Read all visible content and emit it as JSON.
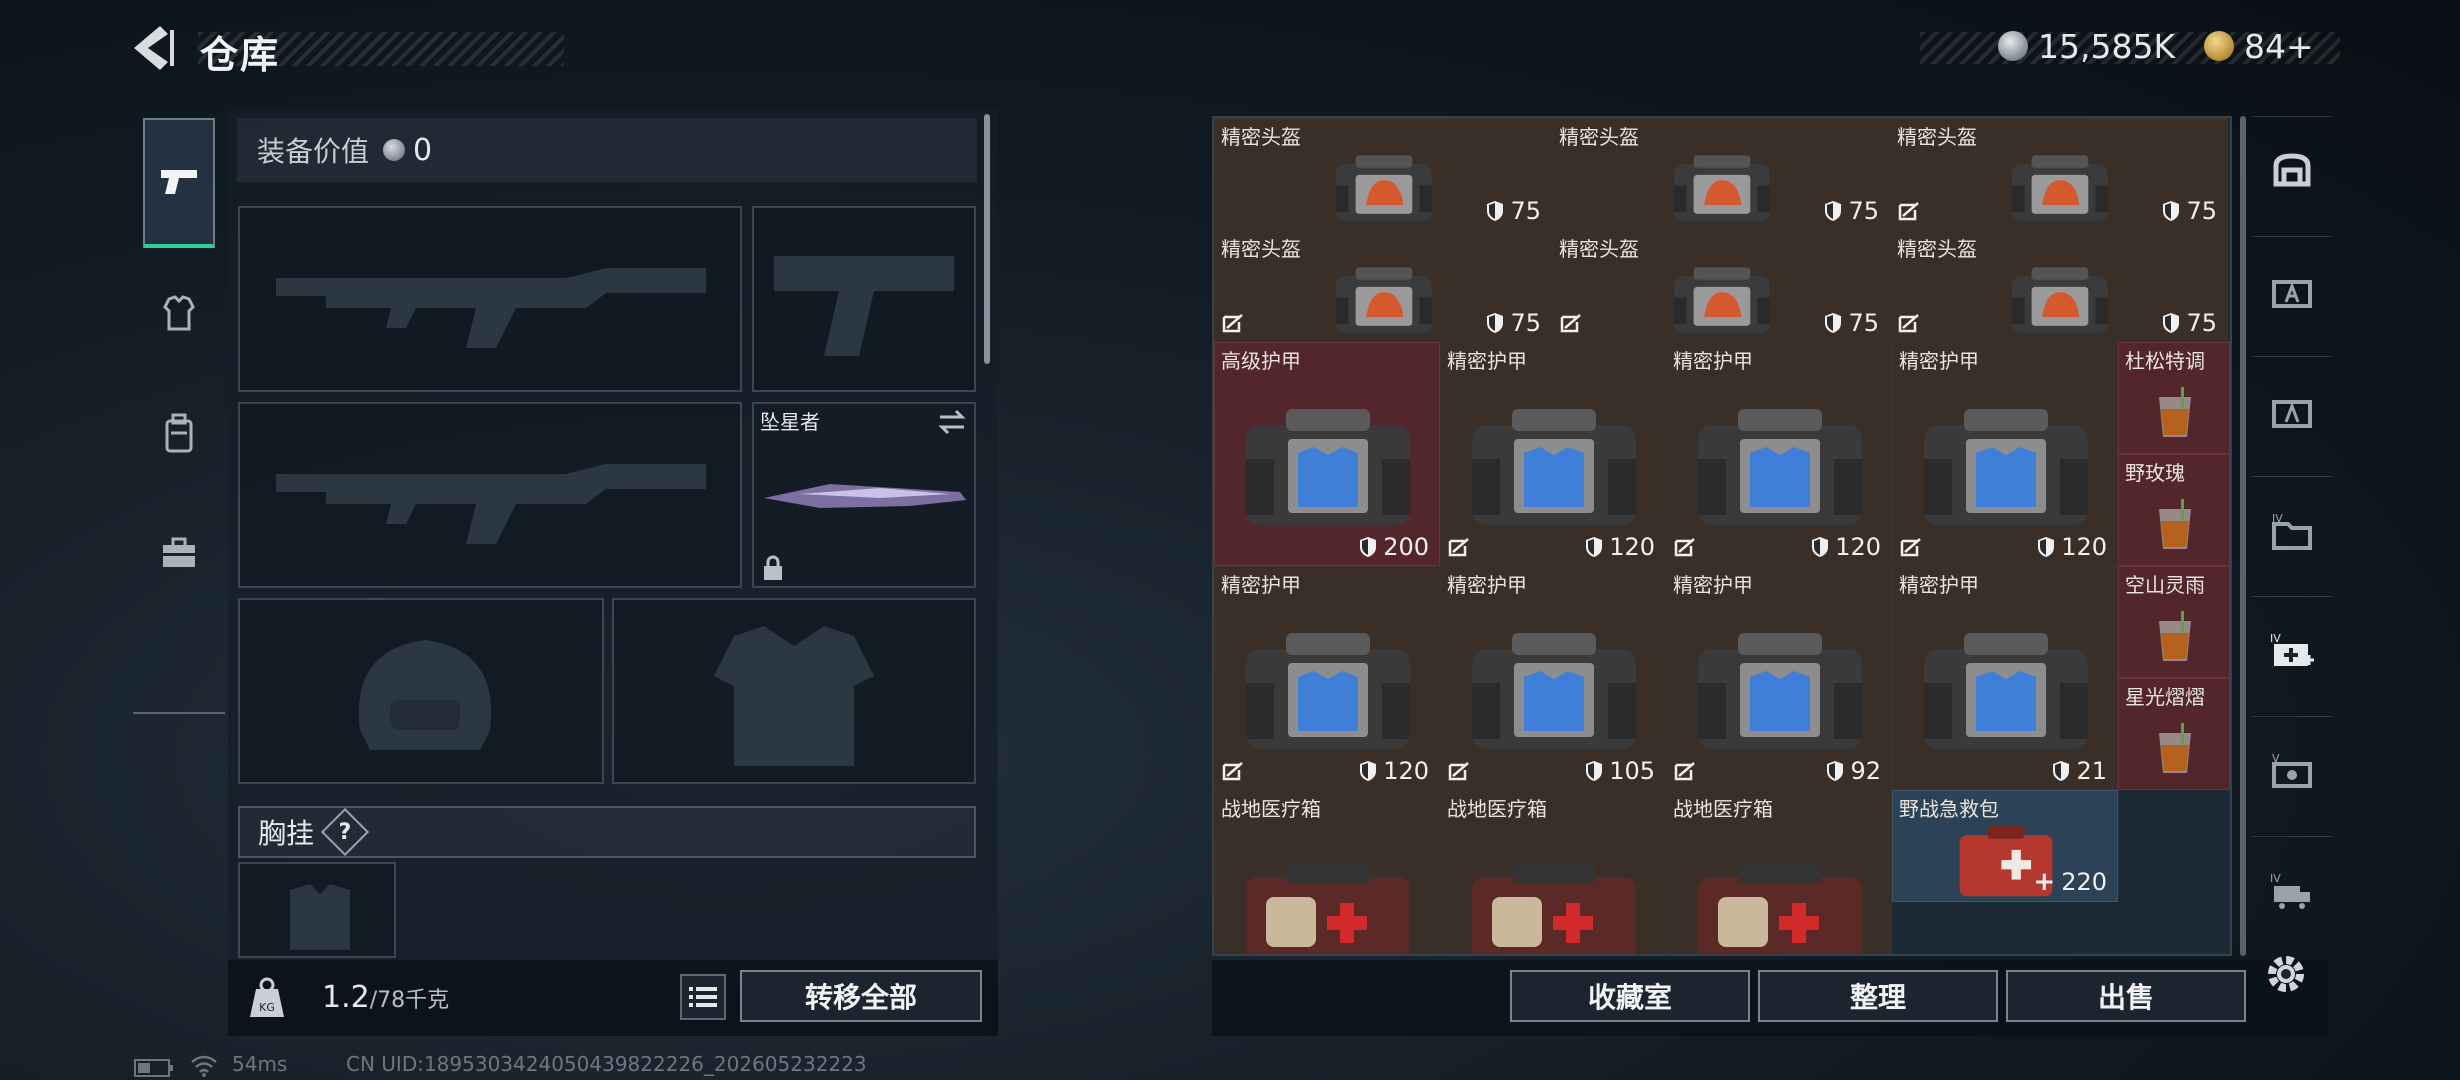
{
  "header": {
    "title": "仓库",
    "currency1": "15,585K",
    "currency2": "84+"
  },
  "left_tabs": [
    {
      "name": "firearm-tab",
      "icon": "pistol-icon",
      "active": true
    },
    {
      "name": "armor-tab",
      "icon": "armor-icon",
      "active": false
    },
    {
      "name": "backpack-tab",
      "icon": "backpack-icon",
      "active": false
    },
    {
      "name": "toolkit-tab",
      "icon": "toolbox-icon",
      "active": false
    }
  ],
  "equipment": {
    "value_label": "装备价值",
    "value": "0",
    "melee_name": "坠星者",
    "chest_label": "胸挂",
    "chest_help": "?",
    "weight_value": "1.2",
    "weight_capacity": "/78千克",
    "transfer_all": "转移全部"
  },
  "grid": {
    "cells": [
      {
        "name": "精密头盔",
        "dur": "75",
        "type": "helmet",
        "broken": false
      },
      {
        "name": "精密头盔",
        "dur": "75",
        "type": "helmet",
        "broken": false
      },
      {
        "name": "精密头盔",
        "dur": "75",
        "type": "helmet",
        "broken": true
      },
      {
        "name": "精密头盔",
        "dur": "75",
        "type": "helmet",
        "broken": true
      },
      {
        "name": "精密头盔",
        "dur": "75",
        "type": "helmet",
        "broken": true
      },
      {
        "name": "精密头盔",
        "dur": "75",
        "type": "helmet",
        "broken": true
      },
      {
        "name": "高级护甲",
        "dur": "200",
        "type": "armor",
        "broken": false,
        "rarity": "red"
      },
      {
        "name": "精密护甲",
        "dur": "120",
        "type": "armor",
        "broken": true
      },
      {
        "name": "精密护甲",
        "dur": "120",
        "type": "armor",
        "broken": true
      },
      {
        "name": "精密护甲",
        "dur": "120",
        "type": "armor",
        "broken": true
      },
      {
        "name": "精密护甲",
        "dur": "120",
        "type": "armor",
        "broken": true
      },
      {
        "name": "精密护甲",
        "dur": "105",
        "type": "armor",
        "broken": true
      },
      {
        "name": "精密护甲",
        "dur": "92",
        "type": "armor",
        "broken": true
      },
      {
        "name": "精密护甲",
        "dur": "21",
        "type": "armor",
        "broken": false
      },
      {
        "name": "杜松特调",
        "type": "drink"
      },
      {
        "name": "野玫瑰",
        "type": "drink"
      },
      {
        "name": "空山灵雨",
        "type": "drink"
      },
      {
        "name": "星光熠熠",
        "type": "drink"
      },
      {
        "name": "战地医疗箱",
        "type": "medkit"
      },
      {
        "name": "战地医疗箱",
        "type": "medkit"
      },
      {
        "name": "战地医疗箱",
        "type": "medkit"
      },
      {
        "name": "野战急救包",
        "dur": "220",
        "type": "firstaid",
        "rarity": "blue"
      }
    ]
  },
  "actions": {
    "collection": "收藏室",
    "sort": "整理",
    "sell": "出售"
  },
  "side_tabs": [
    "safe-icon",
    "storage-a-icon",
    "storage-b-icon",
    "storage-iv-folder-icon",
    "storage-iv-add-icon",
    "storage-v-icon",
    "storage-iv-truck-icon"
  ],
  "footer": {
    "ping": "54ms",
    "uid": "CN UID:1895303424050439822226_202605232223"
  }
}
